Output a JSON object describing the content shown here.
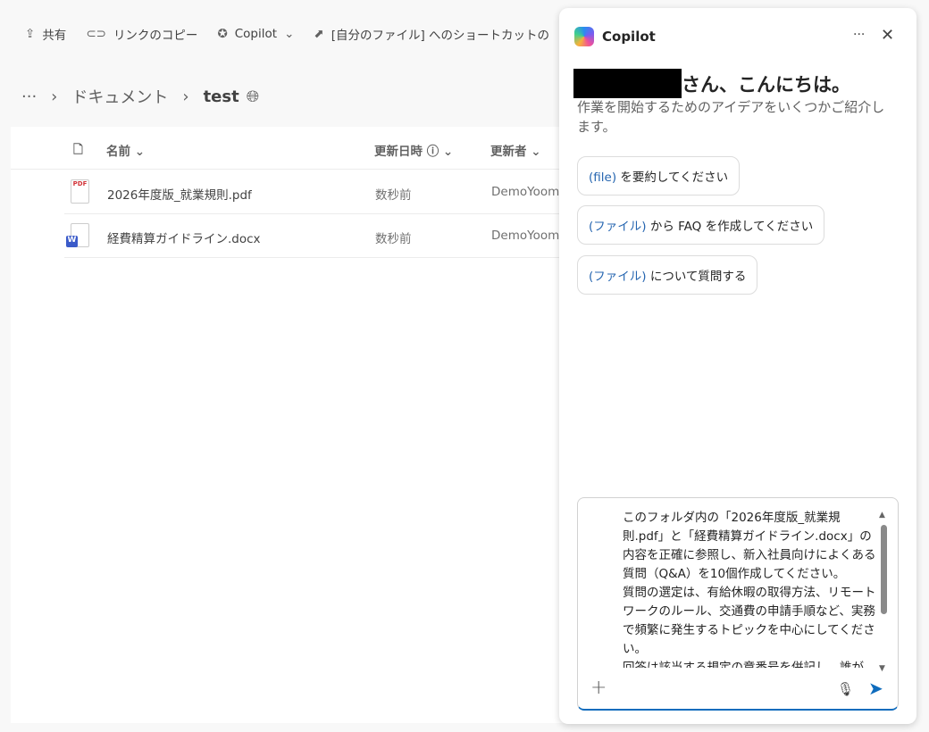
{
  "commandbar": {
    "share": "共有",
    "copy_link": "リンクのコピー",
    "copilot": "Copilot",
    "shortcut": "[自分のファイル] へのショートカットの"
  },
  "breadcrumb": {
    "more": "···",
    "documents": "ドキュメント",
    "current": "test"
  },
  "list": {
    "headers": {
      "name": "名前",
      "modified": "更新日時",
      "modified_by": "更新者"
    },
    "rows": [
      {
        "name": "2026年度版_就業規則.pdf",
        "modified": "数秒前",
        "modified_by": "DemoYoom",
        "type": "pdf"
      },
      {
        "name": "経費精算ガイドライン.docx",
        "modified": "数秒前",
        "modified_by": "DemoYoom",
        "type": "word"
      }
    ]
  },
  "copilot": {
    "title": "Copilot",
    "greeting": "さん、こんにちは。",
    "subtitle": "作業を開始するためのアイデアをいくつかご紹介します。",
    "suggestions": [
      {
        "token": "(file)",
        "text": " を要約してください"
      },
      {
        "token": "(ファイル)",
        "text": " から FAQ を作成してください"
      },
      {
        "token": "(ファイル)",
        "text": " について質問する"
      }
    ],
    "prompt": "このフォルダ内の「2026年度版_就業規則.pdf」と「経費精算ガイドライン.docx」の内容を正確に参照し、新入社員向けによくある質問（Q&A）を10個作成してください。\n質問の選定は、有給休暇の取得方法、リモートワークのルール、交通費の申請手順など、実務で頻繁に発生するトピックを中心にしてください。\n回答は該当する規定の章番号を併記し、誰が"
  }
}
